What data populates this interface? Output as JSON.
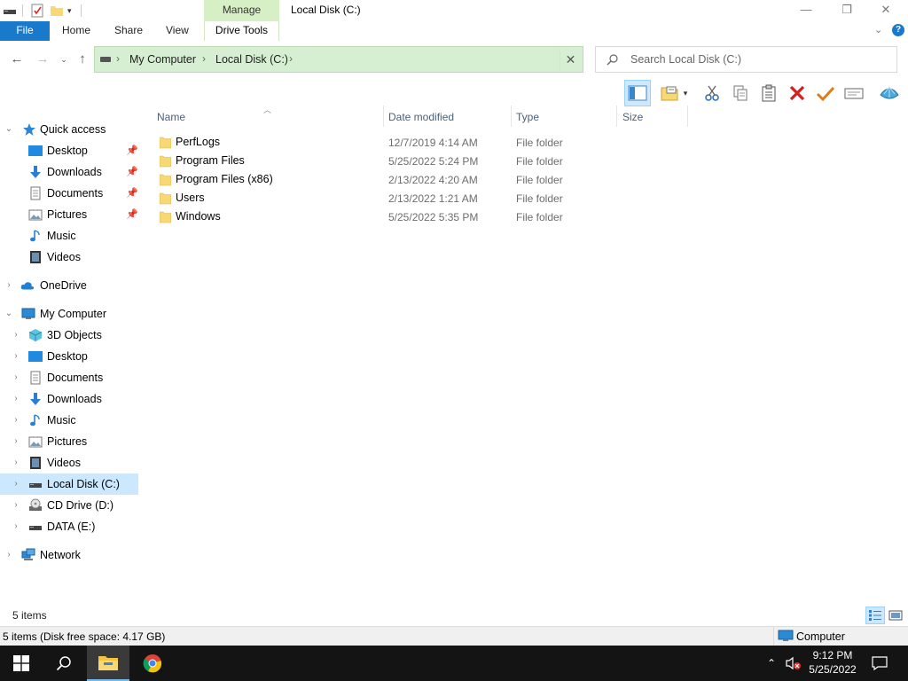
{
  "window": {
    "title": "Local Disk (C:)",
    "contextual_tab_group": "Manage",
    "minimize_glyph": "—",
    "restore_glyph": "❐",
    "close_glyph": "✕"
  },
  "ribbon": {
    "tabs": [
      {
        "label": "File"
      },
      {
        "label": "Home"
      },
      {
        "label": "Share"
      },
      {
        "label": "View"
      },
      {
        "label": "Drive Tools"
      }
    ],
    "help_glyph": "?"
  },
  "address": {
    "crumbs": [
      "My Computer",
      "Local Disk (C:)"
    ],
    "search_placeholder": "Search Local Disk (C:)"
  },
  "nav_pane": {
    "items": [
      {
        "label": "Quick access",
        "icon": "star-icon",
        "expanded": true,
        "pinned": false
      },
      {
        "label": "Desktop",
        "icon": "desktop-icon",
        "pinned": true
      },
      {
        "label": "Downloads",
        "icon": "download-icon",
        "pinned": true
      },
      {
        "label": "Documents",
        "icon": "document-icon",
        "pinned": true
      },
      {
        "label": "Pictures",
        "icon": "picture-icon",
        "pinned": true
      },
      {
        "label": "Music",
        "icon": "music-icon",
        "pinned": false
      },
      {
        "label": "Videos",
        "icon": "video-icon",
        "pinned": false
      },
      {
        "label": "OneDrive",
        "icon": "cloud-icon",
        "expanded": false
      },
      {
        "label": "My Computer",
        "icon": "computer-icon",
        "expanded": true
      },
      {
        "label": "3D Objects",
        "icon": "cube-icon",
        "expanded": false
      },
      {
        "label": "Desktop",
        "icon": "desktop-icon",
        "expanded": false
      },
      {
        "label": "Documents",
        "icon": "document-icon",
        "expanded": false
      },
      {
        "label": "Downloads",
        "icon": "download-icon",
        "expanded": false
      },
      {
        "label": "Music",
        "icon": "music-icon",
        "expanded": false
      },
      {
        "label": "Pictures",
        "icon": "picture-icon",
        "expanded": false
      },
      {
        "label": "Videos",
        "icon": "video-icon",
        "expanded": false
      },
      {
        "label": "Local Disk (C:)",
        "icon": "drive-icon",
        "expanded": false,
        "selected": true
      },
      {
        "label": "CD Drive (D:)",
        "icon": "cd-drive-icon",
        "expanded": false
      },
      {
        "label": "DATA (E:)",
        "icon": "drive-icon",
        "expanded": false
      },
      {
        "label": "Network",
        "icon": "network-icon",
        "expanded": false
      }
    ]
  },
  "file_list": {
    "columns": [
      "Name",
      "Date modified",
      "Type",
      "Size"
    ],
    "rows": [
      {
        "name": "PerfLogs",
        "date": "12/7/2019 4:14 AM",
        "type": "File folder"
      },
      {
        "name": "Program Files",
        "date": "5/25/2022 5:24 PM",
        "type": "File folder"
      },
      {
        "name": "Program Files (x86)",
        "date": "2/13/2022 4:20 AM",
        "type": "File folder"
      },
      {
        "name": "Users",
        "date": "2/13/2022 1:21 AM",
        "type": "File folder"
      },
      {
        "name": "Windows",
        "date": "5/25/2022 5:35 PM",
        "type": "File folder"
      }
    ]
  },
  "status": {
    "item_count": "5 items",
    "details": "5 items (Disk free space: 4.17 GB)",
    "location": "Computer"
  },
  "taskbar": {
    "time": "9:12 PM",
    "date": "5/25/2022"
  },
  "colors": {
    "file_tab": "#1979ca",
    "manage_tab": "#d7efc5",
    "address_bg": "#d6eed1",
    "selection": "#cce8ff",
    "folder": "#f8d775",
    "taskbar": "#141414"
  }
}
